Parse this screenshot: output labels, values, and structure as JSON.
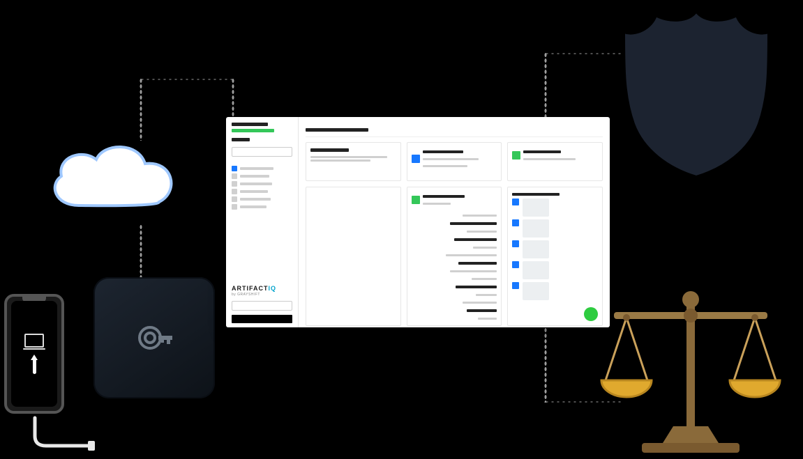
{
  "brand": {
    "name_a": "ARTIFACT",
    "name_b": "IQ",
    "sub": "by GRAYSHIFT"
  },
  "icons": {
    "cloud": "cloud-icon",
    "phone": "phone-icon",
    "graykey": "graykey-device-icon",
    "badge": "police-badge-icon",
    "scales": "scales-of-justice-icon",
    "dashboard": "dashboard-window",
    "key": "key-icon",
    "laptop": "laptop-icon",
    "arrow": "upload-arrow-icon"
  },
  "colors": {
    "green": "#34c759",
    "blue": "#1778ff",
    "gold": "#e0a92e",
    "brown": "#7a5a2f",
    "badgeFill": "#1c2330",
    "cloudStroke": "#9fc8ff"
  }
}
